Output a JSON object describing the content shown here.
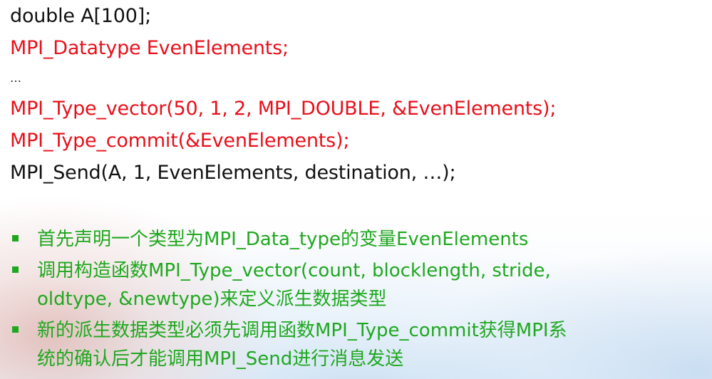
{
  "code": {
    "line1": "double A[100];",
    "line2": "MPI_Datatype EvenElements;",
    "line3": "…",
    "line4": "MPI_Type_vector(50, 1, 2, MPI_DOUBLE, &EvenElements);",
    "line5": "MPI_Type_commit(&EvenElements);",
    "line6": "MPI_Send(A, 1, EvenElements, destination, …);"
  },
  "colors": {
    "code_black": "#111111",
    "code_red": "#e8101a",
    "bullet_green": "#1fa81f"
  },
  "bullets": [
    {
      "lines": [
        "首先声明一个类型为MPI_Data_type的变量EvenElements"
      ]
    },
    {
      "lines": [
        "调用构造函数MPI_Type_vector(count, blocklength, stride,",
        "oldtype, &newtype)来定义派生数据类型"
      ]
    },
    {
      "lines": [
        "新的派生数据类型必须先调用函数MPI_Type_commit获得MPI系",
        "统的确认后才能调用MPI_Send进行消息发送"
      ]
    }
  ]
}
